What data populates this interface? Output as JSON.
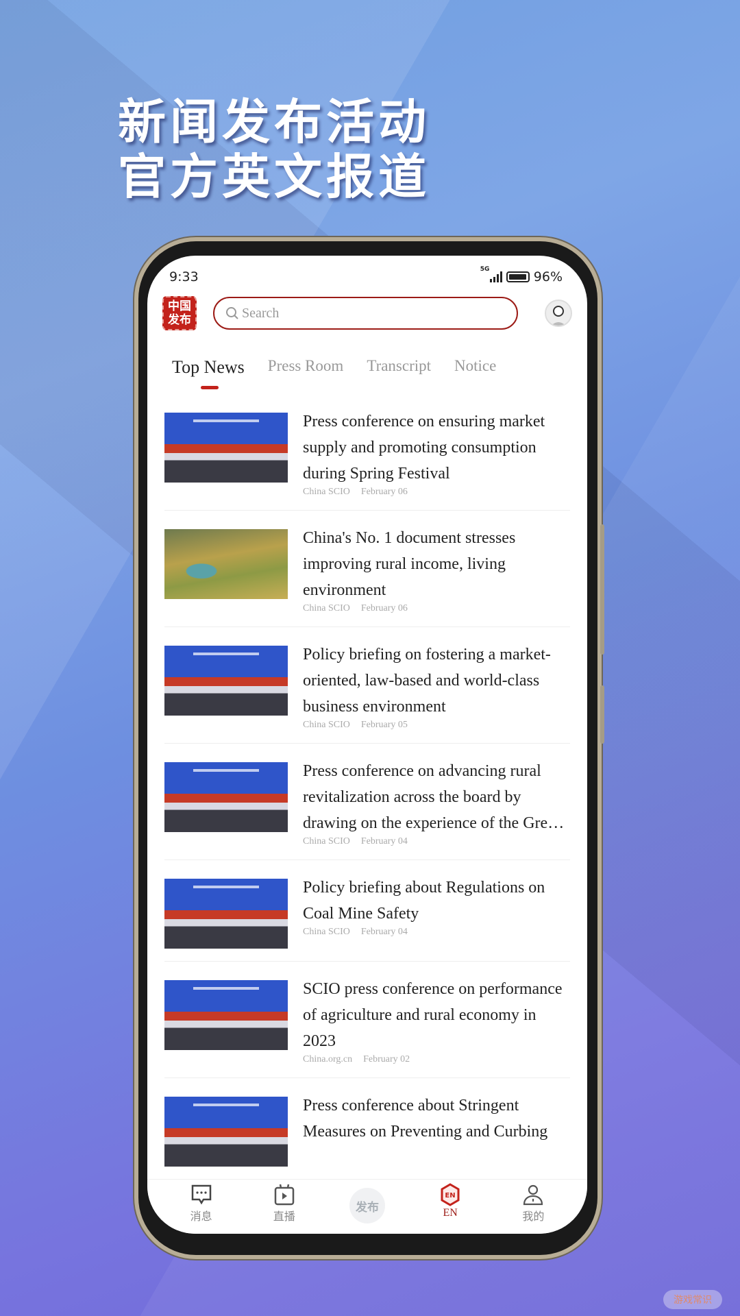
{
  "promo": {
    "line1": "新闻发布活动",
    "line2": "官方英文报道"
  },
  "status": {
    "time": "9:33",
    "network": "5G",
    "battery": "96%",
    "battery_level": 0.96
  },
  "header": {
    "logo_text": "中国发布",
    "logo_line1": "中国",
    "logo_line2": "发布",
    "search_placeholder": "Search"
  },
  "tabs": [
    {
      "label": "Top News",
      "active": true
    },
    {
      "label": "Press Room"
    },
    {
      "label": "Transcript"
    },
    {
      "label": "Notice"
    }
  ],
  "news": [
    {
      "title": "Press conference on ensuring market supply and promoting consumption during Spring Festival",
      "source": "China SCIO",
      "date": "February 06",
      "image": "press-conference"
    },
    {
      "title": "China's No. 1 document stresses improving rural income, living environment",
      "source": "China SCIO",
      "date": "February 06",
      "image": "rural-landscape"
    },
    {
      "title": "Policy briefing on fostering a market-oriented, law-based and world-class business environment",
      "source": "China SCIO",
      "date": "February 05",
      "image": "press-conference"
    },
    {
      "title": "Press conference on advancing rural revitalization across the board by drawing on the experience of the Green Rural Revival Program",
      "source": "China SCIO",
      "date": "February 04",
      "image": "press-conference"
    },
    {
      "title": "Policy briefing about Regulations on Coal Mine Safety",
      "source": "China SCIO",
      "date": "February 04",
      "image": "press-conference"
    },
    {
      "title": "SCIO press conference on performance of agriculture and rural economy in 2023",
      "source": "China.org.cn",
      "date": "February 02",
      "image": "press-conference"
    },
    {
      "title": "Press conference about Stringent Measures on Preventing and Curbing",
      "source": "",
      "date": "",
      "image": "press-conference"
    }
  ],
  "nav": [
    {
      "label": "消息",
      "icon": "message-icon"
    },
    {
      "label": "直播",
      "icon": "live-tv-icon"
    },
    {
      "label": "发布",
      "icon": "publish-icon"
    },
    {
      "label": "EN",
      "icon": "en-icon",
      "active": true
    },
    {
      "label": "我的",
      "icon": "profile-icon"
    }
  ],
  "colors": {
    "accent": "#c3221b",
    "search_border": "#9c1b16"
  },
  "watermark": "游戏常识"
}
